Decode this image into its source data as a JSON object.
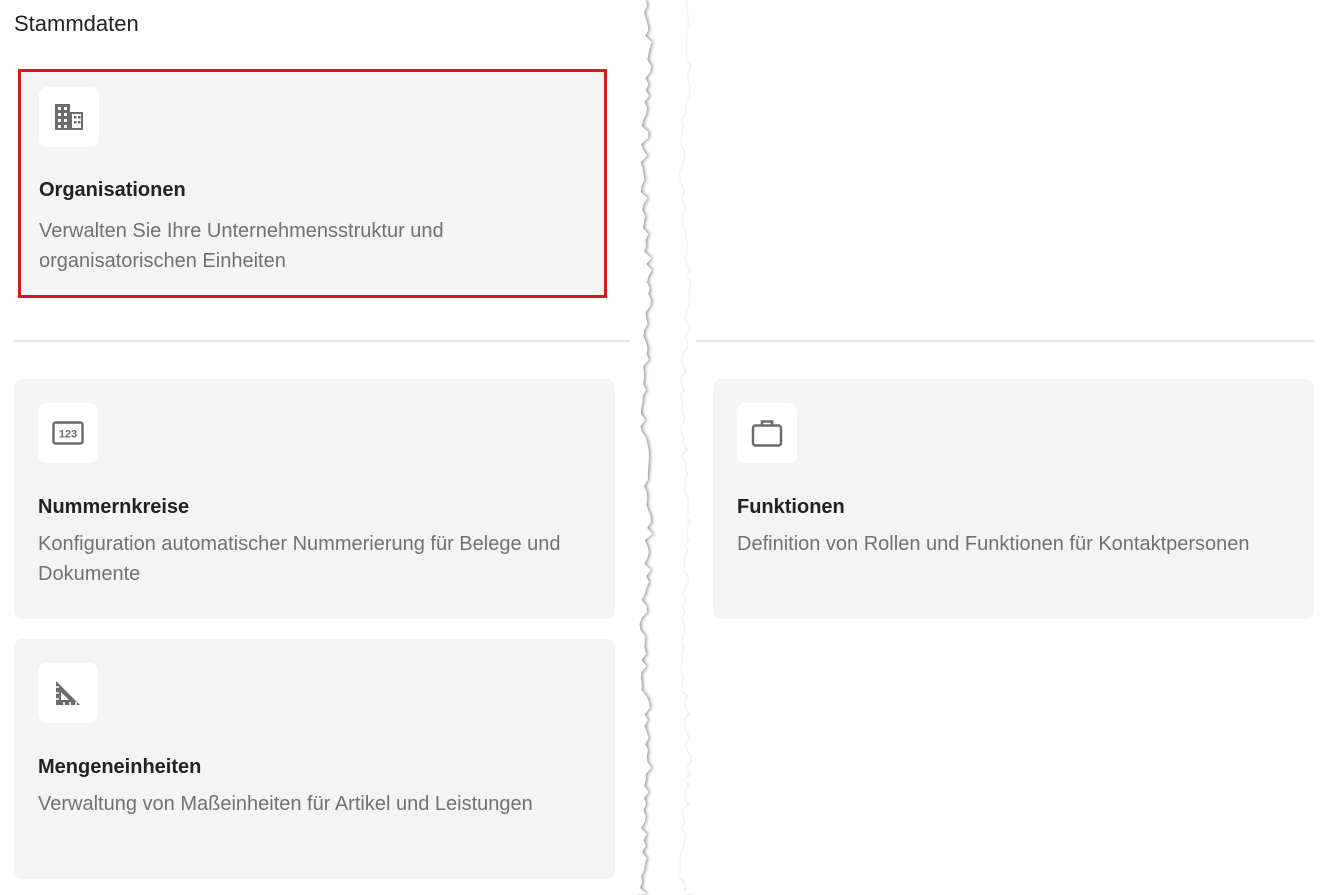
{
  "page": {
    "title": "Stammdaten"
  },
  "cards": [
    {
      "id": "organisationen",
      "icon": "building-icon",
      "title": "Organisationen",
      "description": "Verwalten Sie Ihre Unternehmensstruktur und organisatorischen Einheiten",
      "highlighted": true
    },
    {
      "id": "nummernkreise",
      "icon": "number-123-icon",
      "title": "Nummernkreise",
      "description": "Konfiguration automatischer Nummerierung für Belege und Dokumente",
      "highlighted": false
    },
    {
      "id": "funktionen",
      "icon": "briefcase-icon",
      "title": "Funktionen",
      "description": "Definition von Rollen und Funktionen für Kontaktpersonen",
      "highlighted": false
    },
    {
      "id": "mengeneinheiten",
      "icon": "set-square-icon",
      "title": "Mengeneinheiten",
      "description": "Verwaltung von Maßeinheiten für Artikel und Leistungen",
      "highlighted": false
    }
  ],
  "colors": {
    "card_background": "#f4f4f4",
    "highlight_border": "#e01515",
    "icon_color": "#6b6b6b",
    "description_text": "#717171"
  }
}
